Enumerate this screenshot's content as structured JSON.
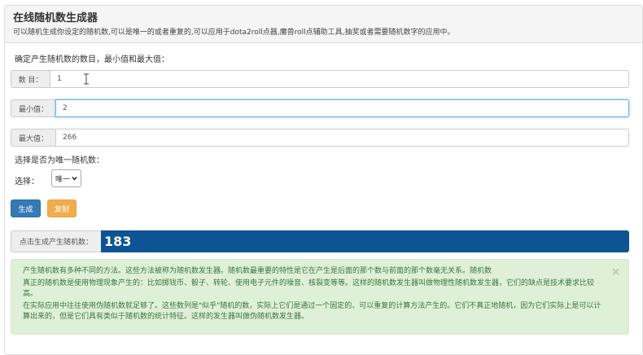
{
  "header": {
    "title": "在线随机数生成器",
    "subtitle": "可以随机生成你设定的随机数,可以是唯一的或者重复的,可以应用于dota2roll点器,魔兽roll点辅助工具,抽奖或者需要随机数字的应用中。"
  },
  "form": {
    "prompt": "确定产生随机数的数目，最小值和最大值：",
    "count": {
      "label": "数 目：",
      "value": "1"
    },
    "min": {
      "label": "最小值：",
      "value": "2"
    },
    "max": {
      "label": "最大值：",
      "value": "266"
    },
    "unique_prompt": "选择是否为唯一随机数：",
    "select": {
      "label": "选择：",
      "value": "唯一"
    }
  },
  "buttons": {
    "generate": "生成",
    "copy": "复制"
  },
  "result": {
    "label": "点击生成产生随机数：",
    "value": "183"
  },
  "info": {
    "p1": "产生随机数有多种不同的方法。这些方法被称为随机数发生器。随机数最重要的特性是它在产生是后面的那个数与前面的那个数毫无关系。随机数",
    "p2": "真正的随机数是使用物理现象产生的：比如掷钱币、骰子、转轮、使用电子元件的噪音、核裂变等等。这样的随机数发生器叫做物理性随机数发生器，它们的缺点是技术要求比较高。",
    "p3": "在实际应用中往往使用伪随机数就足够了。这些数列是\"似乎\"随机的数，实际上它们是通过一个固定的、可以重复的计算方法产生的。它们不真正地随机，因为它们实际上是可以计算出来的，但是它们具有类似于随机数的统计特征。这样的发生器叫做伪随机数发生器。",
    "close": "×"
  },
  "icons": {
    "cursor": "text-cursor-icon",
    "dropdown": "chevron-down-icon"
  },
  "colors": {
    "primary": "#337ab7",
    "warning": "#f0ad4e",
    "result_bg": "#0c5494",
    "alert_bg": "#dff0d8",
    "alert_text": "#3c763d"
  }
}
